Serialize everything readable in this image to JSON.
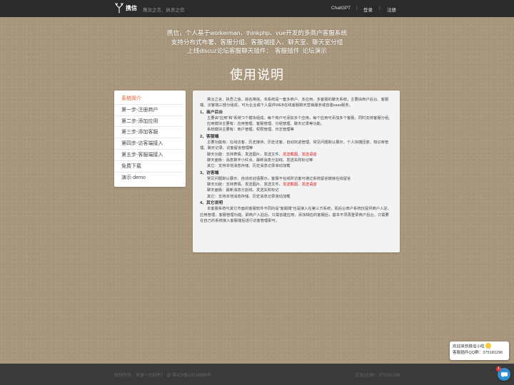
{
  "header": {
    "brand": "携信",
    "slogan": "携汝之言、执吾之信",
    "nav": [
      "ChatGPT",
      "登录",
      "注册"
    ],
    "separator": "|"
  },
  "intro": {
    "line1": "携信，个人基于workerman、thinkphp、vue开发的多商户客服系统",
    "line2": "支持分布式布署、客服分组、客服端接入、聊天室、聊天室分组",
    "line3": "上线discuz论坛客服聊天插件：",
    "link1": "客服插件",
    "link2": "论坛演示"
  },
  "page_title": "使用说明",
  "menu": [
    "系统简介",
    "第一步-注册商户",
    "第二步-添加应用",
    "第三步-添加客服",
    "第四步-访客端接入",
    "第五步-客服端接入",
    "免费下载",
    "演示-demo"
  ],
  "content": {
    "p1": "携汝之言、执吾之信，故名携信。本系统是一套多商户、多应用、多客服的聊天系统，主要由商户后台、客服端、访客端三部分组成，可为企业或个人提供WEB在线客服聊天营销服务或自建saas服务。",
    "s1_title": "1、商户后台",
    "s1_p1": "主要由\"应用\"和\"系统\"2个模块组成。每个商户可添加多个应用，每个应用可添加多个客服，同时支持客服分组。",
    "s1_p2": "应用模块主要有：应用管理、客服管理、分组管理、聊天记录等功能。",
    "s1_p3": "系统模块主要有：商户管理、权限管理、日志管理等",
    "s2_title": "2、客服端",
    "s2_p1": "主要功能有：在线访客、历史接待、历史访客、自动欢迎管理、常见问题默认展示、个人快捷回复、知识库管理、聊天记录、访客留言管理等",
    "s2_p2_a": "聊天功能：支持表情、发送图片、发送文件、",
    "s2_p2_r1": "发送截图",
    "s2_p2_sep": "、",
    "s2_p2_r2": "发送语音",
    "s2_p3": "聊天面板：消息数字小红点、最新消息分割线、发送失败标记等",
    "s2_p4": "其它：支持本地消息存储、历史消息记录滚动加载",
    "s3_title": "3、访客端",
    "s3_p1": "常见问题默认展示、自动欢迎语展示，客服不在线时访客可通过系统留言链接在线留言",
    "s3_p2_a": "聊天功能：支持表情、发送图片、发送文件、",
    "s3_p2_r1": "发送截图",
    "s3_p2_sep": "、",
    "s3_p2_r2": "发送语音",
    "s3_p3": "聊天面板：最新消息分割线、发送失败标记",
    "s3_p4": "其它：支持本地消息存储、历史消息记录滚动加载",
    "s4_title": "4、其它说明",
    "s4_p1": "本客服系统与其它市面的客服软件不同的是\"客服端\"也是接入在第三方系统，而后台商户系统仅提供商户入驻、应用管理、客服管理功能。即商户入驻后，只需创建应用、添加相应的客服后，基本不须再登录商户后台，只需要在自己的系统接入客服端后进行访客管理即可。"
  },
  "footer": {
    "copyright": "版权所有，保留一切权利！ @ 冀ICP备13018889号",
    "qq_group": "交流QQ群：375181296"
  },
  "chat_widget": {
    "greeting": "欢迎来到携信小哇",
    "qq_line": "客服插件QQ群：375181296",
    "badge": "1"
  },
  "colors": {
    "background": "#a8977c",
    "topbar": "#2b2b2b",
    "footer": "#3a3a3a",
    "active_menu": "#e4572e",
    "highlight_red": "#e02020",
    "chat_button": "#2f8ed1"
  }
}
